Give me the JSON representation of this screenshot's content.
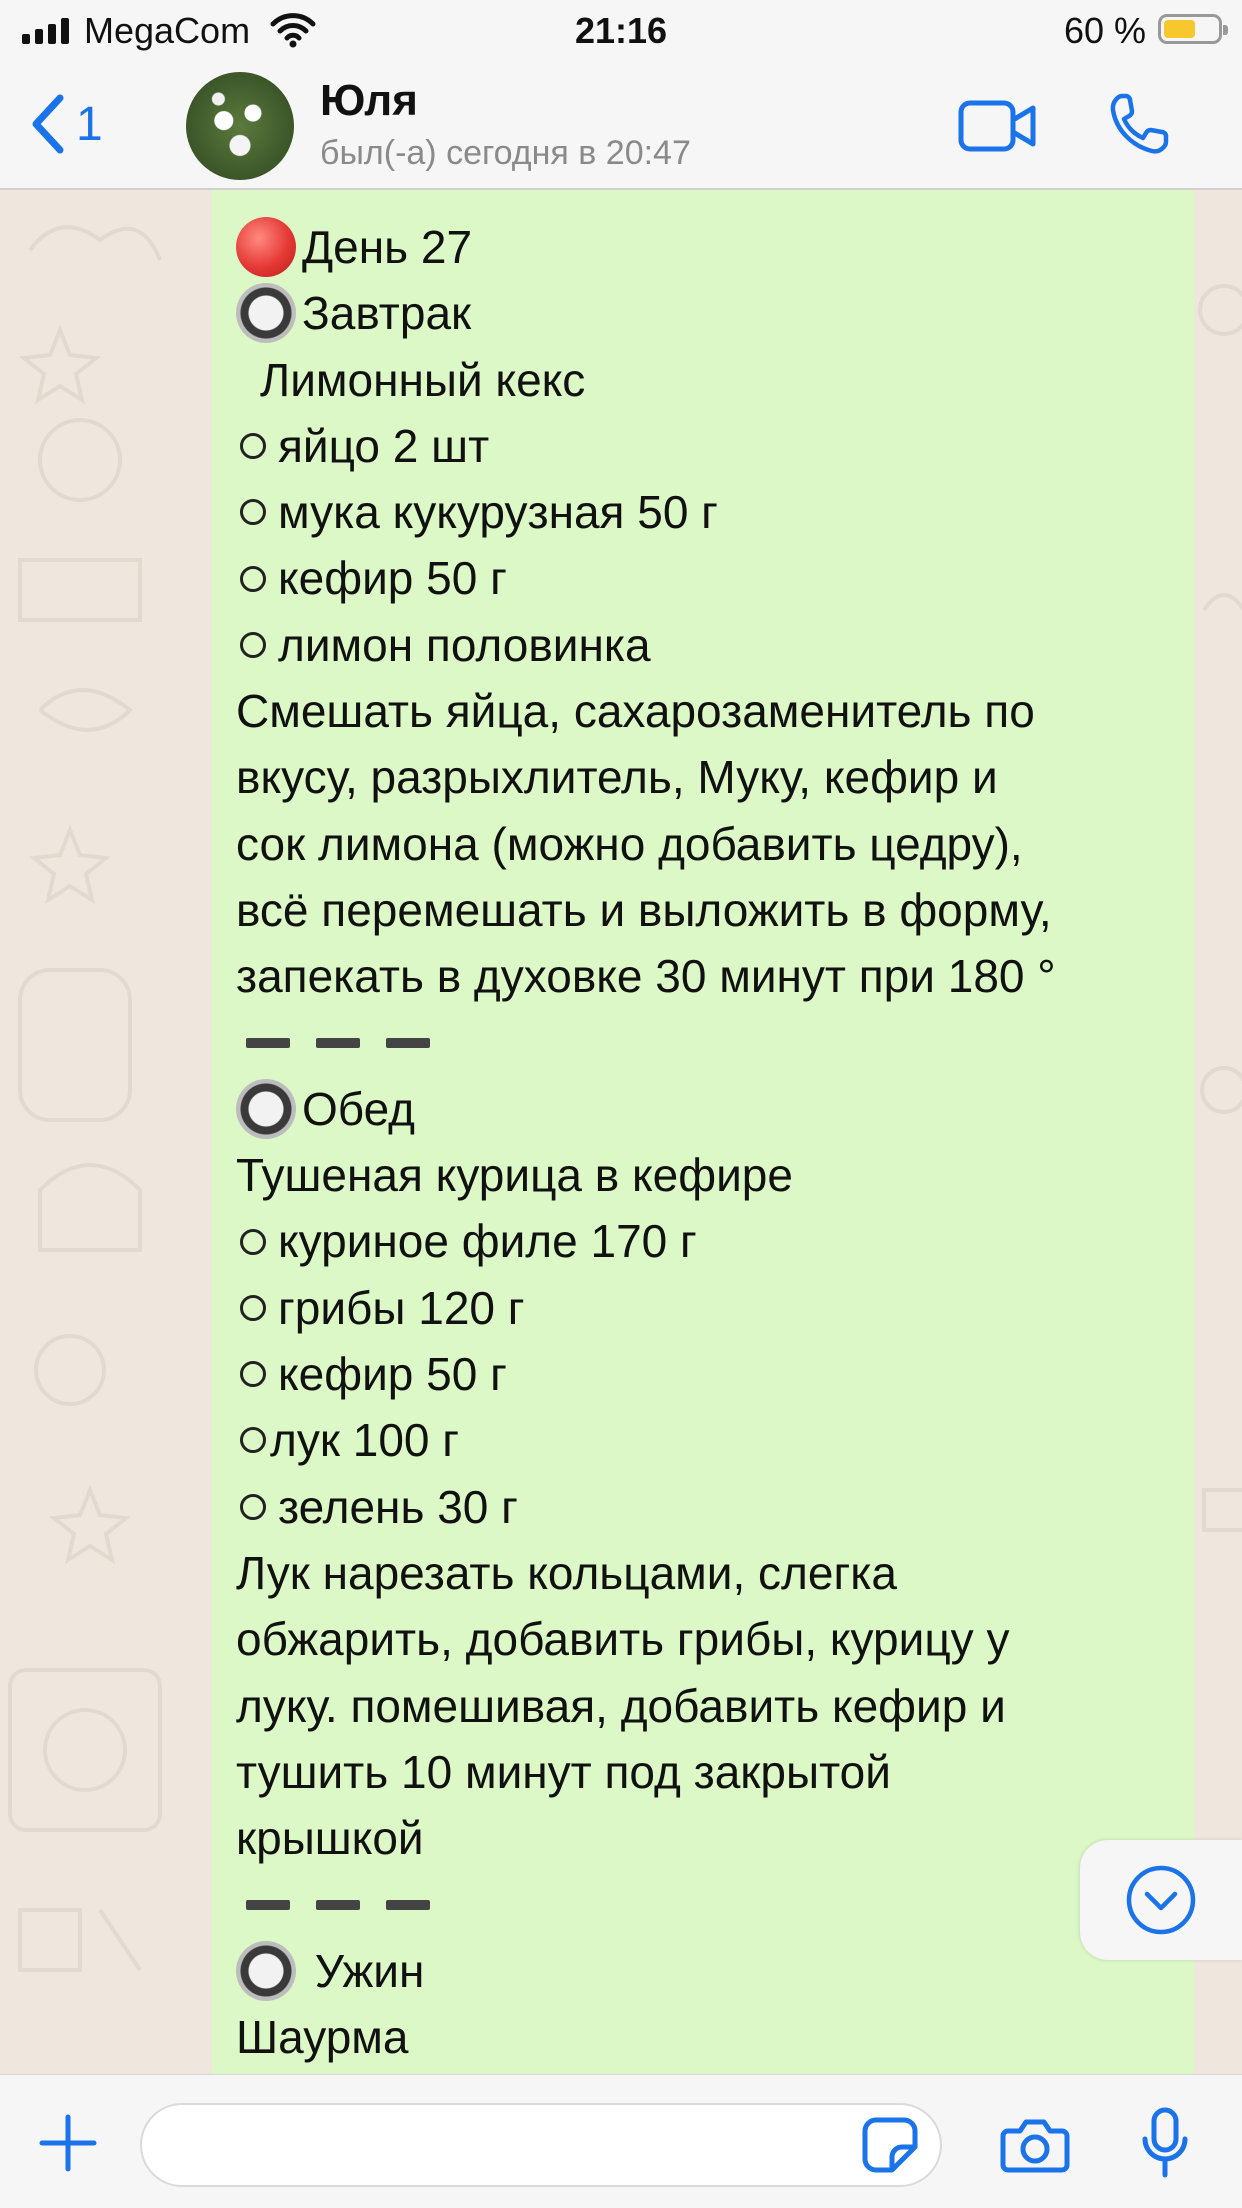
{
  "status_bar": {
    "carrier": "MegaCom",
    "time": "21:16",
    "battery_percent": "60 %",
    "battery_level": 0.6
  },
  "header": {
    "back_count": "1",
    "contact_name": "Юля",
    "last_seen": "был(-а) сегодня в 20:47"
  },
  "message": {
    "lines": [
      {
        "kind": "red",
        "text": "День 27"
      },
      {
        "kind": "radio",
        "text": "Завтрак"
      },
      {
        "kind": "indent",
        "text": "Лимонный кекс"
      },
      {
        "kind": "bullet",
        "text": "яйцо 2 шт"
      },
      {
        "kind": "bullet",
        "text": "мука кукурузная 50 г"
      },
      {
        "kind": "bullet",
        "text": "кефир 50 г"
      },
      {
        "kind": "bullet",
        "text": "лимон половинка"
      },
      {
        "kind": "text",
        "text": "Смешать яйца, сахарозаменитель по"
      },
      {
        "kind": "text",
        "text": "вкусу, разрыхлитель, Муку, кефир и"
      },
      {
        "kind": "text",
        "text": "сок лимона (можно добавить цедру),"
      },
      {
        "kind": "text",
        "text": "всё перемешать и выложить в форму,"
      },
      {
        "kind": "text",
        "text": "запекать в духовке 30 минут при 180 °"
      },
      {
        "kind": "dashes",
        "text": ""
      },
      {
        "kind": "radio",
        "text": "Обед"
      },
      {
        "kind": "text",
        "text": "Тушеная курица в кефире"
      },
      {
        "kind": "bullet",
        "text": "куриное филе 170 г"
      },
      {
        "kind": "bullet",
        "text": "грибы 120 г"
      },
      {
        "kind": "bullet",
        "text": "кефир 50 г"
      },
      {
        "kind": "bullet-tight",
        "text": "лук 100 г"
      },
      {
        "kind": "bullet",
        "text": "зелень 30 г"
      },
      {
        "kind": "text",
        "text": "Лук нарезать кольцами, слегка"
      },
      {
        "kind": "text",
        "text": "обжарить, добавить грибы, курицу у"
      },
      {
        "kind": "text",
        "text": "луку. помешивая, добавить кефир и"
      },
      {
        "kind": "text",
        "text": "тушить 10 минут под закрытой"
      },
      {
        "kind": "text",
        "text": "крышкой"
      },
      {
        "kind": "dashes",
        "text": ""
      },
      {
        "kind": "radio",
        "text": " Ужин"
      },
      {
        "kind": "text",
        "text": "Шаурма"
      }
    ]
  },
  "input": {
    "value": "",
    "placeholder": ""
  },
  "colors": {
    "accent": "#1A73E8",
    "bubble": "#DCF8C6",
    "chat_bg": "#EFE7DE"
  },
  "icons": [
    "back-chevron-icon",
    "video-camera-icon",
    "phone-icon",
    "chevron-down-icon",
    "plus-icon",
    "sticker-icon",
    "camera-icon",
    "microphone-icon"
  ]
}
